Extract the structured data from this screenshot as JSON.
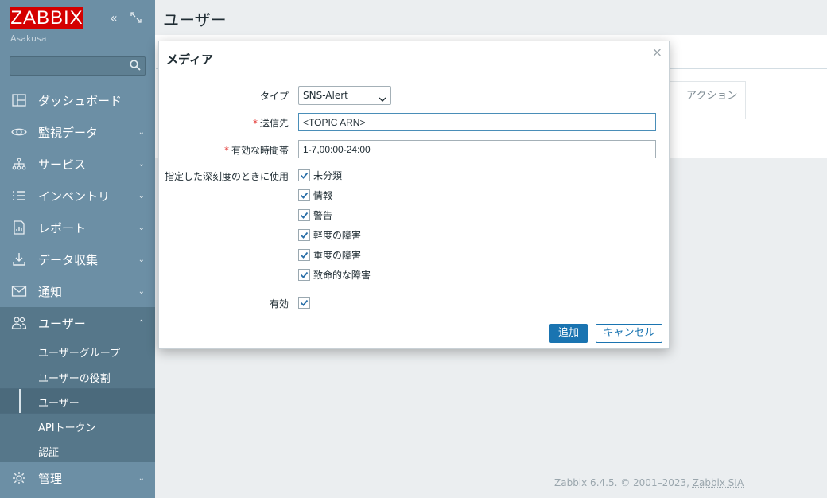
{
  "sidebar": {
    "logo": "ZABBIX",
    "server_name": "Asakusa",
    "collapse_icon": "double-chevron-left-icon",
    "kiosk_icon": "expand-icon",
    "search": {
      "value": "",
      "placeholder": ""
    },
    "items": [
      {
        "label": "ダッシュボード",
        "icon": "dashboard-icon",
        "chevron": ""
      },
      {
        "label": "監視データ",
        "icon": "eye-icon",
        "chevron": "⌄"
      },
      {
        "label": "サービス",
        "icon": "services-icon",
        "chevron": "⌄"
      },
      {
        "label": "インベントリ",
        "icon": "list-icon",
        "chevron": "⌄"
      },
      {
        "label": "レポート",
        "icon": "report-icon",
        "chevron": "⌄"
      },
      {
        "label": "データ収集",
        "icon": "download-icon",
        "chevron": "⌄"
      },
      {
        "label": "通知",
        "icon": "envelope-icon",
        "chevron": "⌄"
      },
      {
        "label": "ユーザー",
        "icon": "users-icon",
        "chevron": "⌃"
      }
    ],
    "submenu": [
      {
        "label": "ユーザーグループ"
      },
      {
        "label": "ユーザーの役割"
      },
      {
        "label": "ユーザー"
      },
      {
        "label": "APIトークン"
      },
      {
        "label": "認証"
      }
    ],
    "last_item": {
      "label": "管理",
      "icon": "gear-icon",
      "chevron": "⌄"
    }
  },
  "page": {
    "title": "ユーザー",
    "bg_column": "アクション",
    "footer_text": "Zabbix 6.4.5. © 2001–2023, ",
    "footer_link": "Zabbix SIA"
  },
  "modal": {
    "title": "メディア",
    "close": "×",
    "type_label": "タイプ",
    "type_value": "SNS-Alert",
    "sendto_label": "送信先",
    "sendto_value": "<TOPIC ARN>",
    "period_label": "有効な時間帯",
    "period_value": "1-7,00:00-24:00",
    "severity_label": "指定した深刻度のときに使用",
    "severities": [
      {
        "label": "未分類",
        "checked": true
      },
      {
        "label": "情報",
        "checked": true
      },
      {
        "label": "警告",
        "checked": true
      },
      {
        "label": "軽度の障害",
        "checked": true
      },
      {
        "label": "重度の障害",
        "checked": true
      },
      {
        "label": "致命的な障害",
        "checked": true
      }
    ],
    "enabled_label": "有効",
    "enabled_checked": true,
    "add_button": "追加",
    "cancel_button": "キャンセル"
  },
  "colors": {
    "sidebar": "#6c8fa5",
    "logo": "#d40000",
    "primary": "#1a74b1",
    "required": "#e33734"
  }
}
